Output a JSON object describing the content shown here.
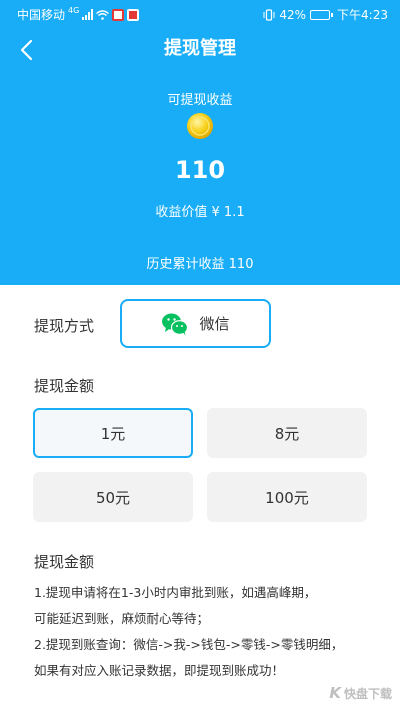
{
  "status_bar": {
    "carrier": "中国移动",
    "network": "4G",
    "battery_percent": "42%",
    "battery_level": 0.42,
    "time": "下午4:23"
  },
  "header": {
    "title": "提现管理",
    "balance_label": "可提现收益",
    "balance_amount": "110",
    "balance_value": "收益价值 ¥ 1.1",
    "history_total": "历史累计收益 110"
  },
  "withdraw_method": {
    "label": "提现方式",
    "option": "微信"
  },
  "withdraw_amount": {
    "label": "提现金额",
    "options": [
      "1元",
      "8元",
      "50元",
      "100元"
    ],
    "selected_index": 0
  },
  "notes": {
    "title": "提现金额",
    "lines": [
      "1.提现申请将在1-3小时内审批到账，如遇高峰期，",
      "可能延迟到账，麻烦耐心等待；",
      "2.提现到账查询：微信->我->钱包->零钱->零钱明细，",
      "如果有对应入账记录数据，即提现到账成功！"
    ]
  },
  "watermark": {
    "brand": "K",
    "text": "快盘下载"
  },
  "colors": {
    "primary": "#18adf6",
    "wechat": "#07c160",
    "coin": "#f5c20e",
    "option_bg": "#f2f2f2"
  }
}
